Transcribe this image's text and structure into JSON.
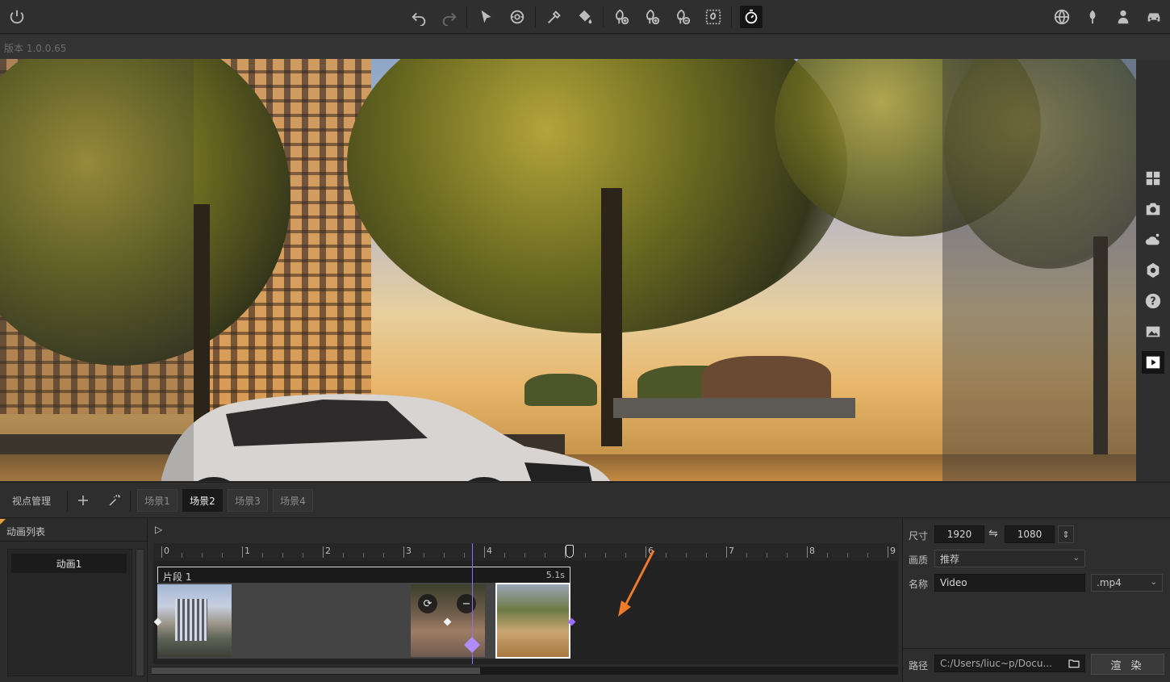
{
  "version": "版本 1.0.0.65",
  "toolbar": {
    "left": [
      "power-icon"
    ],
    "center": [
      "undo-icon",
      "redo-icon",
      "select-arrow-icon",
      "orbit-icon",
      "eyedropper-icon",
      "paint-bucket-icon",
      "tree-add-icon",
      "tree-add-alt-icon",
      "tree-remove-icon",
      "tree-select-icon",
      "timer-icon"
    ],
    "right": [
      "globe-icon",
      "plant-icon",
      "person-icon",
      "car-icon"
    ]
  },
  "side_panel": [
    "grid-icon",
    "camera-icon",
    "weather-icon",
    "settings-icon",
    "help-icon",
    "image-icon",
    "video-icon"
  ],
  "scene_bar": {
    "viewpoint_label": "视点管理",
    "tabs": [
      "场景1",
      "场景2",
      "场景3",
      "场景4"
    ],
    "active_tab": 1
  },
  "anim_panel": {
    "title": "动画列表",
    "items": [
      "动画1"
    ]
  },
  "timeline": {
    "play_glyph": "▷",
    "ruler_labels": [
      "0",
      "1",
      "2",
      "3",
      "4",
      "5",
      "6",
      "7",
      "8",
      "9"
    ],
    "clip": {
      "name": "片段 1",
      "duration": "5.1s"
    },
    "playhead_seconds": 3.85,
    "scroll_fraction": 0.44
  },
  "render": {
    "size_label": "尺寸",
    "width": "1920",
    "swap_glyph": "⇋",
    "height": "1080",
    "quality_label": "画质",
    "quality_value": "推荐",
    "name_label": "名称",
    "name_value": "Video",
    "format_value": ".mp4",
    "path_label": "路径",
    "path_value": "C:/Users/liuc~p/Docu...",
    "render_button": "渲 染"
  },
  "colors": {
    "accent_purple": "#9a6cff",
    "annotation_arrow": "#f07a2a",
    "corner_mark": "#e2a13a"
  }
}
